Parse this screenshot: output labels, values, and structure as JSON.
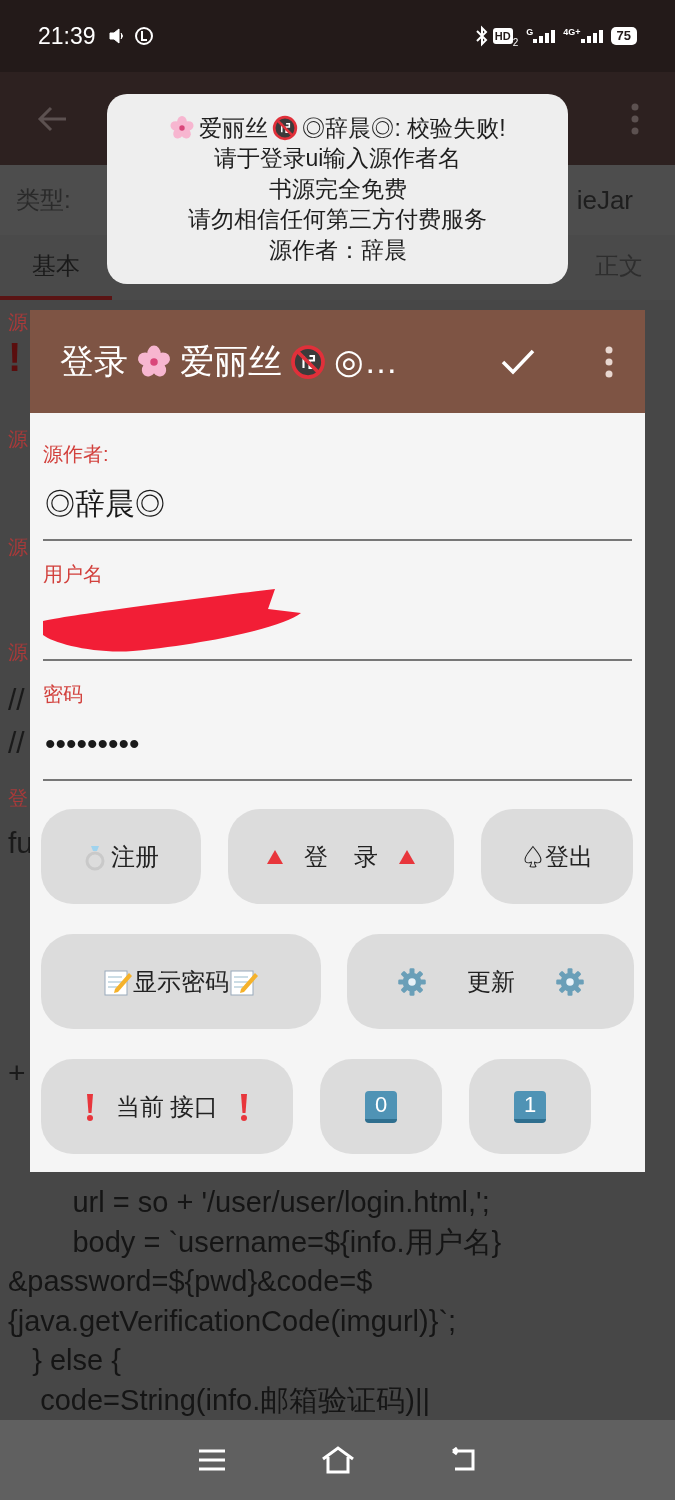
{
  "status_bar": {
    "time": "21:39",
    "hd": "HD",
    "hd_sub": "2",
    "network_left": "G",
    "network_right": "4G+",
    "battery": "75"
  },
  "type_row": {
    "label": "类型:",
    "value": "ieJar"
  },
  "tabs": [
    {
      "label": "基本",
      "selected": true
    },
    {
      "label": "正文",
      "selected": false
    }
  ],
  "fragments": [
    {
      "kind": "label",
      "text": "源"
    },
    {
      "kind": "alert",
      "text": "!"
    },
    {
      "kind": "label",
      "text": "源"
    },
    {
      "kind": "label",
      "text": "源"
    },
    {
      "kind": "label",
      "text": "源"
    },
    {
      "kind": "value",
      "text": "//"
    },
    {
      "kind": "value",
      "text": "//"
    },
    {
      "kind": "label",
      "text": "登"
    },
    {
      "kind": "value",
      "text": "fu"
    },
    {
      "kind": "value",
      "text": "+"
    }
  ],
  "code_lines": [
    "        url = so + '/user/user/login.html,';",
    "        body = `username=${info.用户名}",
    "&password=${pwd}&code=$",
    "{java.getVerificationCode(imgurl)}`;",
    "   } else {",
    "    code=String(info.邮箱验证码)||"
  ],
  "toast": {
    "first_line": [
      {
        "kind": "flower"
      },
      {
        "kind": "text",
        "text": "爱丽丝"
      },
      {
        "kind": "no18"
      },
      {
        "kind": "text",
        "text": "◎辞晨◎: 校验失败!"
      }
    ],
    "lines": [
      "请于登录ui输入源作者名",
      "书源完全免费",
      "请勿相信任何第三方付费服务",
      "源作者：辞晨"
    ]
  },
  "dialog": {
    "title": [
      {
        "kind": "text",
        "text": "登录"
      },
      {
        "kind": "flower"
      },
      {
        "kind": "text",
        "text": "爱丽丝"
      },
      {
        "kind": "no18"
      },
      {
        "kind": "text",
        "text": "◎…"
      }
    ],
    "fields": [
      {
        "label": "源作者:",
        "value": "◎辞晨◎",
        "redacted": false
      },
      {
        "label": "用户名",
        "redacted": true
      },
      {
        "label": "密码",
        "value": "•••••••••",
        "redacted": false
      }
    ],
    "button_rows": [
      [
        {
          "kind": "ring",
          "label": "注册"
        },
        {
          "kind": "triangle",
          "label": "登    录"
        },
        {
          "kind": "plain",
          "label": "♤登出"
        }
      ],
      [
        {
          "kind": "memo",
          "label": "显示密码"
        },
        {
          "kind": "gear",
          "label": "更新"
        }
      ],
      [
        {
          "kind": "exclaim",
          "label": "当前 接口"
        },
        {
          "kind": "keycap",
          "label": "0"
        },
        {
          "kind": "keycap",
          "label": "1"
        }
      ]
    ]
  }
}
